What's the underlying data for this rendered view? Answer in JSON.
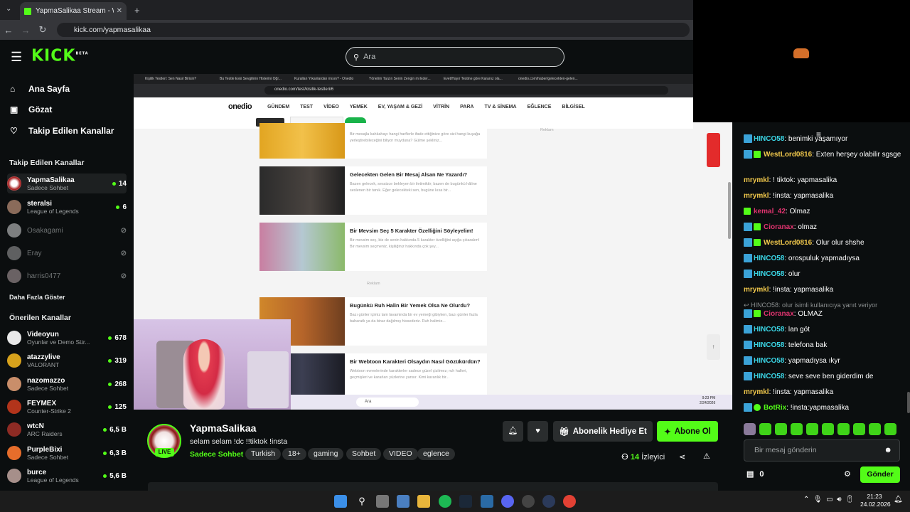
{
  "browser": {
    "tab_title": "YapmaSalikaa Stream - Wat",
    "url": "kick.com/yapmasalikaa"
  },
  "header": {
    "logo": "KICK",
    "logo_sup": "BETA",
    "search_placeholder": "Ara"
  },
  "sidebar": {
    "main_nav": [
      {
        "label": "Ana Sayfa",
        "icon": "home-icon"
      },
      {
        "label": "Gözat",
        "icon": "browse-icon"
      },
      {
        "label": "Takip Edilen Kanallar",
        "icon": "heart-icon"
      }
    ],
    "followed_heading": "Takip Edilen Kanallar",
    "followed": [
      {
        "name": "YapmaSalikaa",
        "game": "Sadece Sohbet",
        "viewers": "14",
        "live": true
      },
      {
        "name": "steralsi",
        "game": "League of Legends",
        "viewers": "6",
        "live": true
      },
      {
        "name": "Osakagami",
        "game": "",
        "viewers": "",
        "live": false
      },
      {
        "name": "Eray",
        "game": "",
        "viewers": "",
        "live": false
      },
      {
        "name": "harris0477",
        "game": "",
        "viewers": "",
        "live": false
      }
    ],
    "show_more": "Daha Fazla Göster",
    "recommended_heading": "Önerilen Kanallar",
    "recommended": [
      {
        "name": "Videoyun",
        "game": "Oyunlar ve Demo Sür...",
        "viewers": "678"
      },
      {
        "name": "atazzylive",
        "game": "VALORANT",
        "viewers": "319"
      },
      {
        "name": "nazomazzo",
        "game": "Sadece Sohbet",
        "viewers": "268"
      },
      {
        "name": "FEYMEX",
        "game": "Counter-Strike 2",
        "viewers": "125"
      },
      {
        "name": "wtcN",
        "game": "ARC Raiders",
        "viewers": "6,5 B"
      },
      {
        "name": "PurpleBixi",
        "game": "Sadece Sohbet",
        "viewers": "6,3 B"
      },
      {
        "name": "burce",
        "game": "League of Legends",
        "viewers": "5,6 B"
      }
    ]
  },
  "video": {
    "inner_tabs": [
      "Kişilik Testleri: Sen Nasıl Birisin?",
      "Bu Testle Eski Sevgilinin Hislerini Öğr...",
      "Kurallan Yıkanlardan mısın? - Onedio",
      "Yönetim Tarzın Senin Zengin mi Eder...",
      "Evet/Hayır Testine göre Karanız ola...",
      "onedio.com/haber/gelecekten-gelen..."
    ],
    "inner_url": "onedio.com/test/kisilik-testleri/6",
    "site_logo": "onedio",
    "site_nav": [
      "GÜNDEM",
      "TEST",
      "VİDEO",
      "YEMEK",
      "EV, YAŞAM & GEZİ",
      "VİTRİN",
      "PARA",
      "TV & SİNEMA",
      "EĞLENCE",
      "BİLGİSEL"
    ],
    "cards": [
      {
        "title": "",
        "desc": "Bir mesajla kahkahayı hangi harflerle ifade ettiğinize göre sizi hangi kuşağa yerleştirebileceğini biliyor muyduna? Gülme şekliniz..."
      },
      {
        "title": "Gelecekten Gelen Bir Mesaj Alsan Ne Yazardı?",
        "desc": "Bazen gelecek, sessizce bekleyen bir iletimiktir; bazen de bugünkü hâline seslenen bir tanık. Eğer gelecekteki sen, bugüne kısa bir..."
      },
      {
        "title": "Bir Mevsim Seç 5 Karakter Özelliğini Söyleyelim!",
        "desc": "Bir mevsim seç, biz de senin hakkında 5 karakter özelliğini açığa çıkaralım! Bir mevsim seçmeniz, kişiliğiniz hakkında çok şey..."
      },
      {
        "title": "Bugünkü Ruh Halin Bir Yemek Olsa Ne Olurdu?",
        "desc": "Bazı günler içimiz tam lavaminda bir ev yemeği gibiyken, bazı günler fazla baharatlı ya da biraz dağılmış hissederiz. Ruh halimiz..."
      },
      {
        "title": "Bir Webtoon Karakteri Olsaydın Nasıl Gözükürdün?",
        "desc": "Webtoon evrenlerinde karakterler sadece güzel çizilmez; ruh halleri, geçmişleri ve kararları yüzlerine yansır. Kimi karanlık bir..."
      }
    ],
    "ad_label": "Reklam",
    "inner_search": "Ara",
    "inner_time": "9:23 PM",
    "inner_date": "2/24/2026"
  },
  "stream": {
    "name": "YapmaSalikaa",
    "title": "selam selam !dc !!tiktok !insta",
    "category": "Sadece Sohbet",
    "live_label": "LIVE",
    "tags": [
      "Turkish",
      "18+",
      "gaming",
      "Sohbet",
      "VIDEO",
      "eglence"
    ],
    "gift_label": "Abonelik Hediye Et",
    "subscribe_label": "Abone Ol",
    "viewers": "14",
    "viewers_label": "İzleyici"
  },
  "chat": {
    "messages": [
      {
        "user": "HINCO58",
        "text": "benimki yaşamıyor",
        "color": "#3bd6e6",
        "badge": "blue"
      },
      {
        "user": "WestLord0816",
        "text": "Exten herşey olabilir sgsge",
        "color": "#f2c94c",
        "badge": "both"
      },
      {
        "user": "mrymkl",
        "text": "! tiktok: yapmasalika",
        "color": "#f2c94c",
        "badge": "none"
      },
      {
        "user": "mrymkl",
        "text": "!insta: yapmasalika",
        "color": "#f2c94c",
        "badge": "none"
      },
      {
        "user": "kemal_42",
        "text": "Olmaz",
        "color": "#e0346f",
        "badge": "gem"
      },
      {
        "user": "Cioranax",
        "text": "olmaz",
        "color": "#e0346f",
        "badge": "both"
      },
      {
        "user": "WestLord0816",
        "text": "Olur olur shshe",
        "color": "#f2c94c",
        "badge": "both"
      },
      {
        "user": "HINCO58",
        "text": "orospuluk yapmadıysa",
        "color": "#3bd6e6",
        "badge": "blue"
      },
      {
        "user": "HINCO58",
        "text": "olur",
        "color": "#3bd6e6",
        "badge": "blue"
      },
      {
        "user": "mrymkl",
        "text": "!insta: yapmasalika",
        "color": "#f2c94c",
        "badge": "none"
      },
      {
        "user": "Cioranax",
        "text": "OLMAZ",
        "color": "#e0346f",
        "badge": "both"
      },
      {
        "user": "HINCO58",
        "text": "lan göt",
        "color": "#3bd6e6",
        "badge": "blue"
      },
      {
        "user": "HINCO58",
        "text": "telefona bak",
        "color": "#3bd6e6",
        "badge": "blue"
      },
      {
        "user": "HINCO58",
        "text": "yapmadıysa ıkyr",
        "color": "#3bd6e6",
        "badge": "blue"
      },
      {
        "user": "HINCO58",
        "text": "seve seve ben giderdim de",
        "color": "#3bd6e6",
        "badge": "blue"
      },
      {
        "user": "mrymkl",
        "text": "!insta: yapmasalika",
        "color": "#f2c94c",
        "badge": "none"
      },
      {
        "user": "BotRix",
        "text": "!insta:yapmasalika",
        "color": "#53fc18",
        "badge": "bot"
      }
    ],
    "reply_line": "HINCO58: olur isimli kullanıcıya yanıt veriyor",
    "input_placeholder": "Bir mesaj gönderin",
    "points": "0",
    "send_label": "Gönder"
  },
  "taskbar": {
    "time": "21:23",
    "date": "24.02.2026"
  }
}
